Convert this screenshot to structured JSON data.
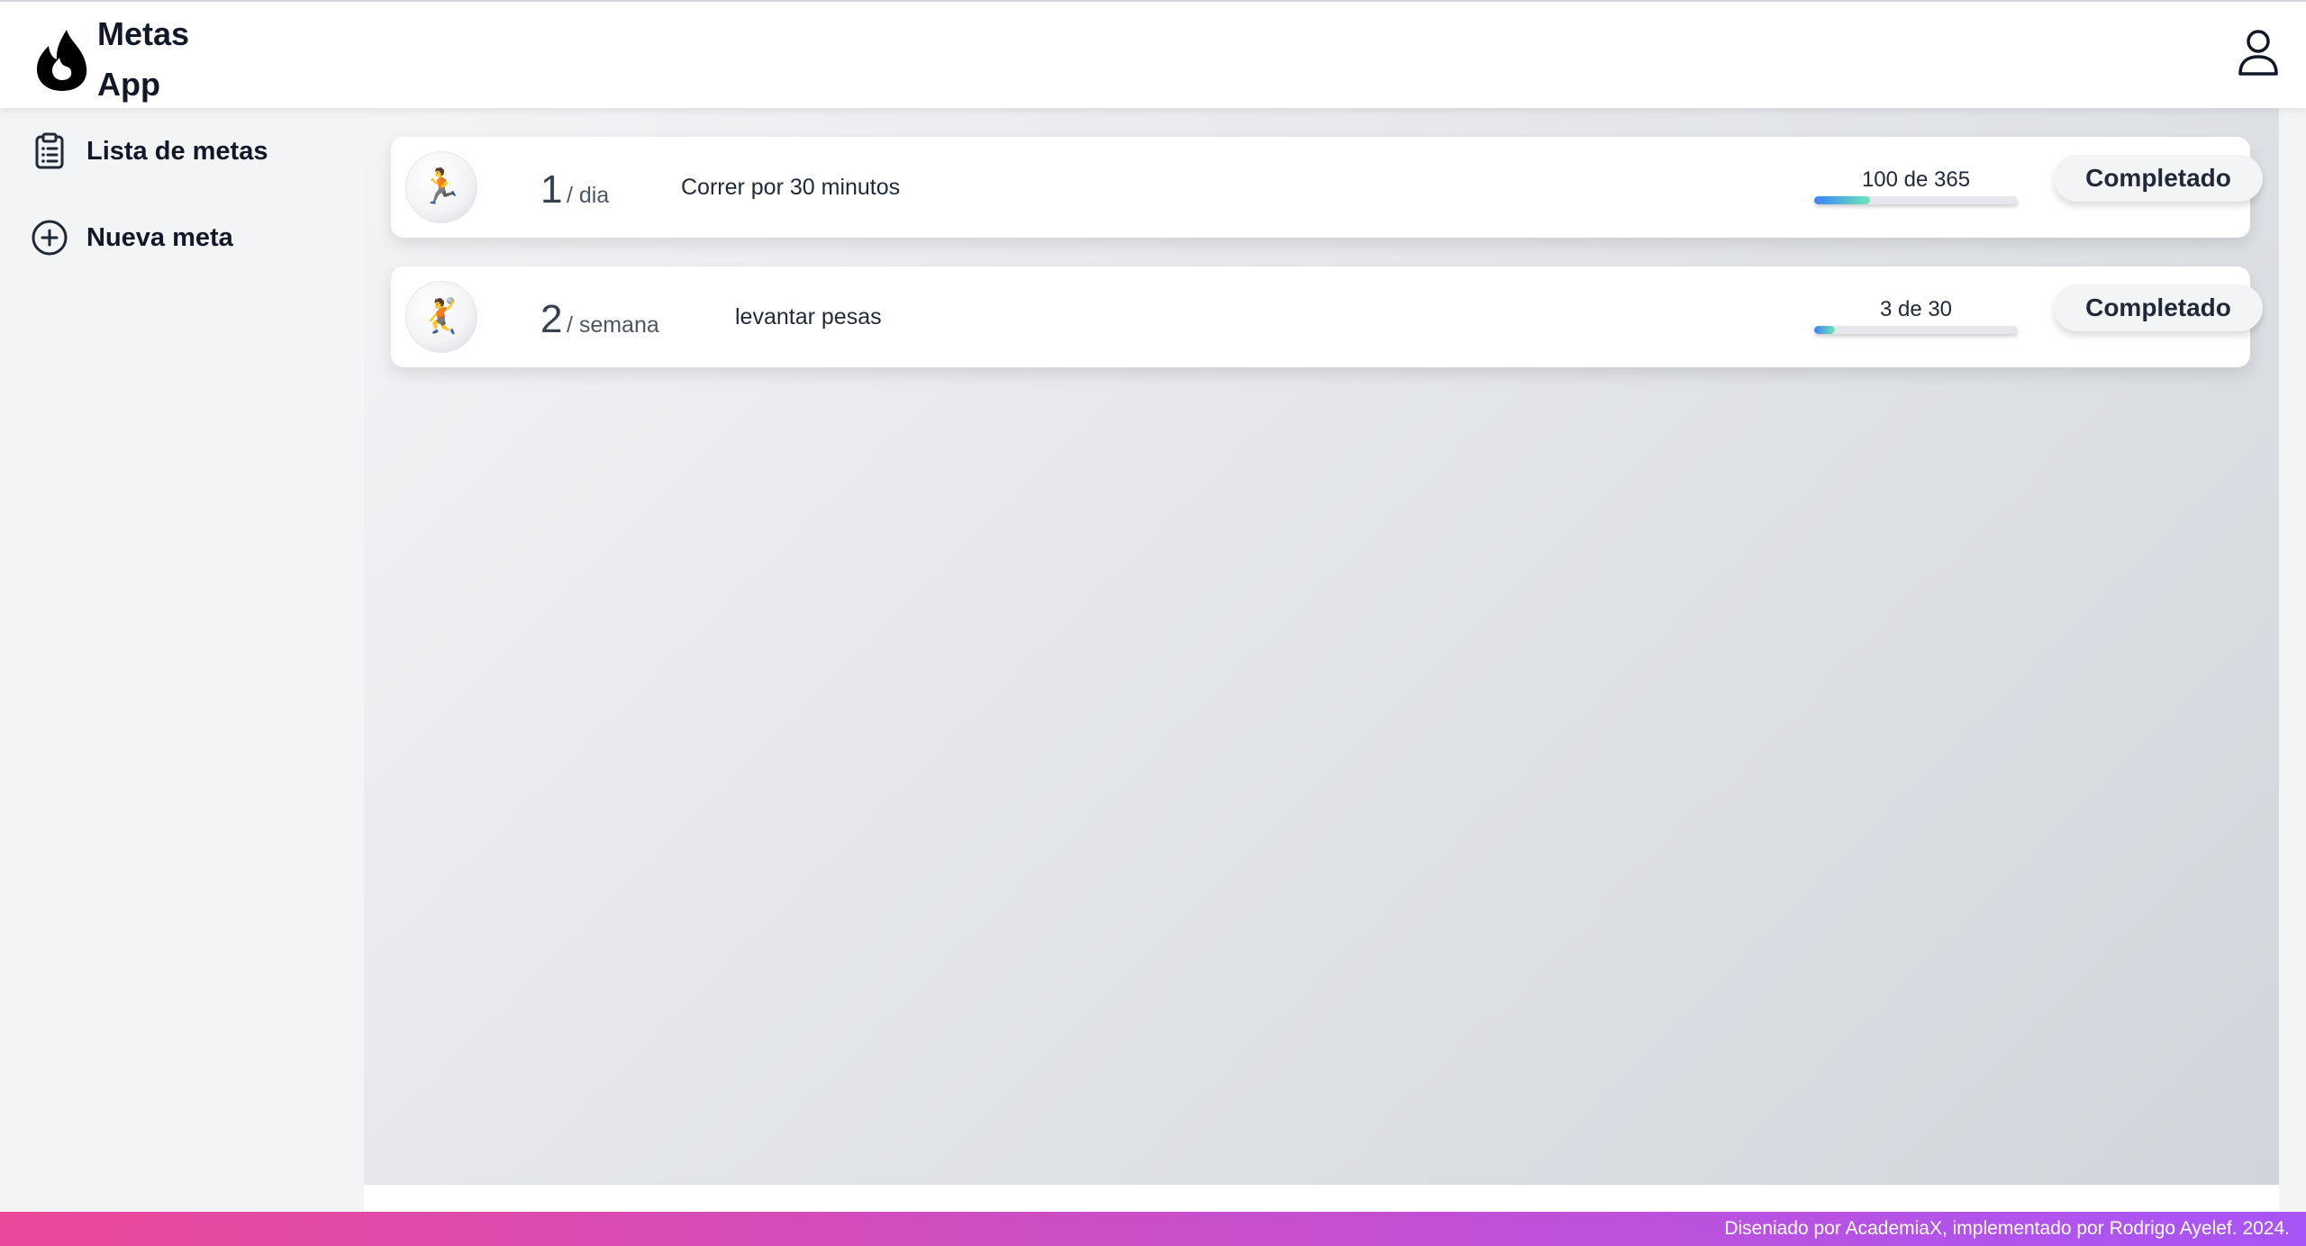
{
  "header": {
    "brand_line1": "Metas",
    "brand_line2": "App",
    "logo_icon": "flame-icon",
    "profile_icon": "user-icon"
  },
  "sidebar": {
    "items": [
      {
        "label": "Lista de metas",
        "icon": "clipboard-list-icon"
      },
      {
        "label": "Nueva meta",
        "icon": "plus-circle-icon"
      }
    ]
  },
  "goals": [
    {
      "icon": "🏃",
      "icon_name": "running-person-icon",
      "count": "1",
      "period": "/ dia",
      "details": "Correr por 30 minutos",
      "progress_text": "100 de 365",
      "completed": 100,
      "target": 365,
      "button_label": "Completado"
    },
    {
      "icon": "🤾",
      "icon_name": "athlete-icon",
      "count": "2",
      "period": "/ semana",
      "details": "levantar pesas",
      "progress_text": "3 de 30",
      "completed": 3,
      "target": 30,
      "button_label": "Completado"
    }
  ],
  "footer": {
    "text": "Diseniado por AcademiaX, implementado por Rodrigo Ayelef. 2024."
  },
  "colors": {
    "progress_start": "#3b82f6",
    "progress_end": "#6ee7b7",
    "footer_start": "#ec4899",
    "footer_end": "#a855f7"
  }
}
